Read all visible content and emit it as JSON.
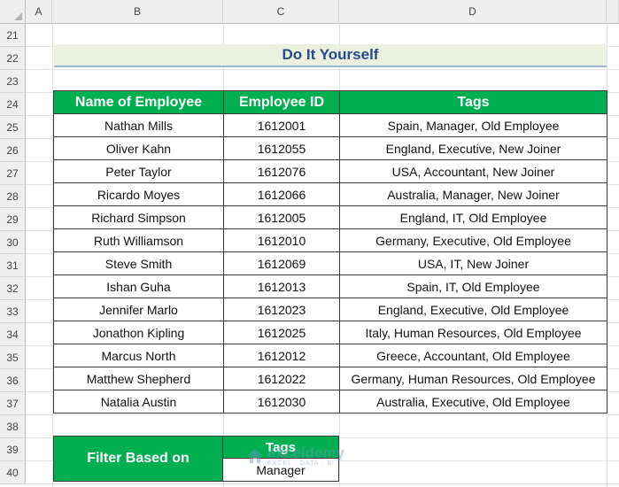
{
  "sheet": {
    "columns": [
      "A",
      "B",
      "C",
      "D"
    ],
    "rows": [
      "21",
      "22",
      "23",
      "24",
      "25",
      "26",
      "27",
      "28",
      "29",
      "30",
      "31",
      "32",
      "33",
      "34",
      "35",
      "36",
      "37",
      "38",
      "39",
      "40"
    ]
  },
  "title": "Do It Yourself",
  "table": {
    "headers": [
      "Name of Employee",
      "Employee ID",
      "Tags"
    ],
    "rows": [
      [
        "Nathan Mills",
        "1612001",
        "Spain, Manager, Old Employee"
      ],
      [
        "Oliver Kahn",
        "1612055",
        "England, Executive, New Joiner"
      ],
      [
        "Peter Taylor",
        "1612076",
        "USA, Accountant, New Joiner"
      ],
      [
        "Ricardo Moyes",
        "1612066",
        "Australia, Manager, New Joiner"
      ],
      [
        "Richard Simpson",
        "1612005",
        "England, IT, Old Employee"
      ],
      [
        "Ruth Williamson",
        "1612010",
        "Germany, Executive, Old Employee"
      ],
      [
        "Steve Smith",
        "1612069",
        "USA, IT, New Joiner"
      ],
      [
        "Ishan Guha",
        "1612013",
        "Spain, IT, Old Employee"
      ],
      [
        "Jennifer Marlo",
        "1612023",
        "England, Executive, Old Employee"
      ],
      [
        "Jonathon Kipling",
        "1612025",
        "Italy, Human Resources, Old Employee"
      ],
      [
        "Marcus North",
        "1612012",
        "Greece, Accountant, Old Employee"
      ],
      [
        "Matthew Shepherd",
        "1612022",
        "Germany, Human Resources, Old Employee"
      ],
      [
        "Natalia Austin",
        "1612030",
        "Australia, Executive, Old Employee"
      ]
    ]
  },
  "filter": {
    "label": "Filter Based on",
    "header": "Tags",
    "value": "Manager"
  },
  "watermark": {
    "name": "exceldemy",
    "tagline": "EXCEL · DATA · BI"
  },
  "colors": {
    "header_green": "#00b050",
    "title_blue": "#254b8c",
    "title_band": "#ecf0df"
  }
}
